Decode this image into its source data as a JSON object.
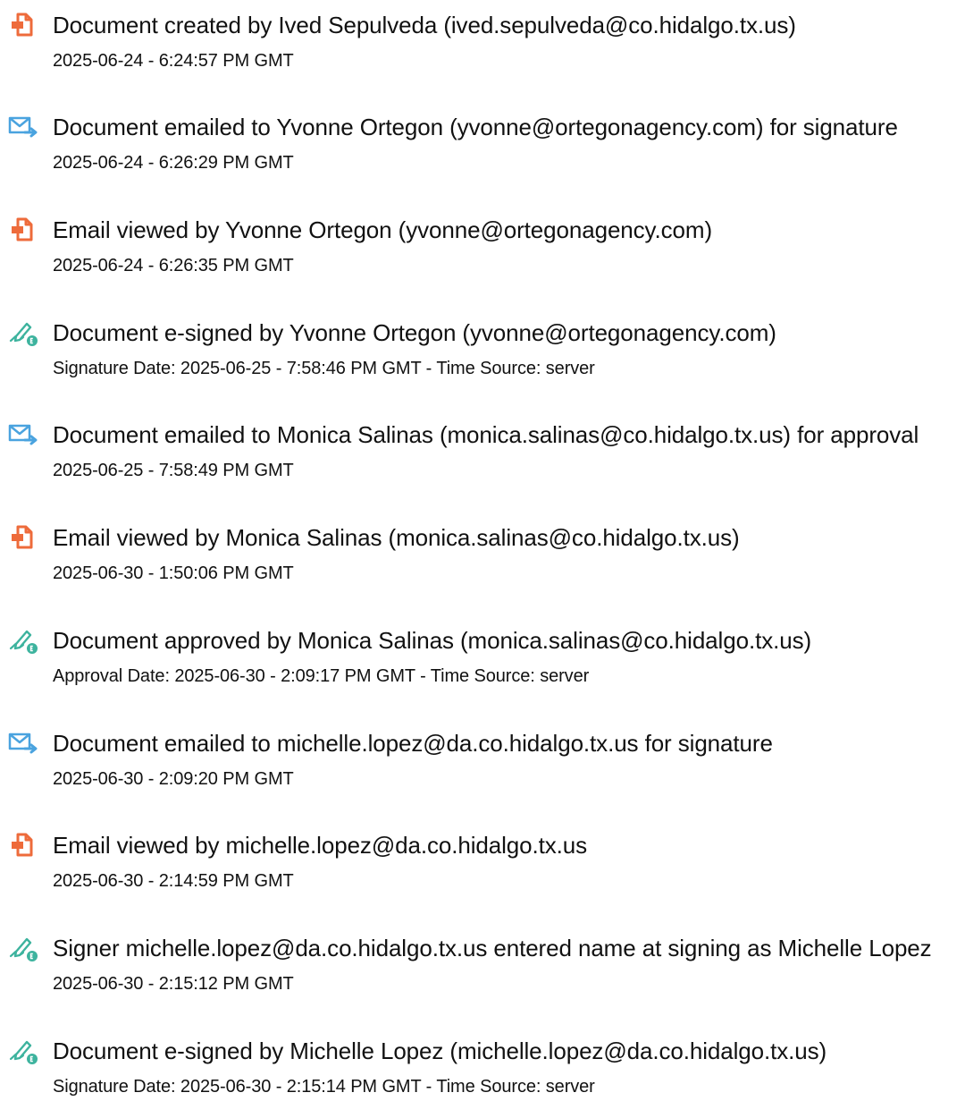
{
  "colors": {
    "doc_icon": "#ee6b3b",
    "email_icon": "#4aa3df",
    "sign_icon": "#3db39e",
    "text": "#111111"
  },
  "events": [
    {
      "icon": "document-icon",
      "title": "Document created by Ived Sepulveda (ived.sepulveda@co.hidalgo.tx.us)",
      "detail": "2025-06-24 - 6:24:57 PM GMT"
    },
    {
      "icon": "email-icon",
      "title": "Document emailed to Yvonne Ortegon (yvonne@ortegonagency.com) for signature",
      "detail": "2025-06-24 - 6:26:29 PM GMT"
    },
    {
      "icon": "document-icon",
      "title": "Email viewed by Yvonne Ortegon (yvonne@ortegonagency.com)",
      "detail": "2025-06-24 - 6:26:35 PM GMT"
    },
    {
      "icon": "esign-icon",
      "title": "Document e-signed by Yvonne Ortegon (yvonne@ortegonagency.com)",
      "detail": "Signature Date: 2025-06-25 - 7:58:46 PM GMT - Time Source: server"
    },
    {
      "icon": "email-icon",
      "title": "Document emailed to Monica Salinas (monica.salinas@co.hidalgo.tx.us) for approval",
      "detail": "2025-06-25 - 7:58:49 PM GMT"
    },
    {
      "icon": "document-icon",
      "title": "Email viewed by Monica Salinas (monica.salinas@co.hidalgo.tx.us)",
      "detail": "2025-06-30 - 1:50:06 PM GMT"
    },
    {
      "icon": "esign-icon",
      "title": "Document approved by Monica Salinas (monica.salinas@co.hidalgo.tx.us)",
      "detail": "Approval Date: 2025-06-30 - 2:09:17 PM GMT - Time Source: server"
    },
    {
      "icon": "email-icon",
      "title": "Document emailed to michelle.lopez@da.co.hidalgo.tx.us for signature",
      "detail": "2025-06-30 - 2:09:20 PM GMT"
    },
    {
      "icon": "document-icon",
      "title": "Email viewed by michelle.lopez@da.co.hidalgo.tx.us",
      "detail": "2025-06-30 - 2:14:59 PM GMT"
    },
    {
      "icon": "esign-icon",
      "title": "Signer michelle.lopez@da.co.hidalgo.tx.us entered name at signing as Michelle Lopez",
      "detail": "2025-06-30 - 2:15:12 PM GMT"
    },
    {
      "icon": "esign-icon",
      "title": "Document e-signed by Michelle Lopez (michelle.lopez@da.co.hidalgo.tx.us)",
      "detail": "Signature Date: 2025-06-30 - 2:15:14 PM GMT - Time Source: server"
    }
  ]
}
